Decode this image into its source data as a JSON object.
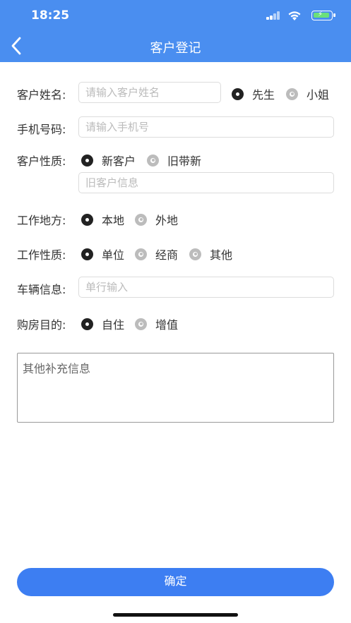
{
  "status_bar": {
    "time": "18:25"
  },
  "header": {
    "title": "客户登记"
  },
  "form": {
    "name": {
      "label": "客户姓名:",
      "placeholder": "请输入客户姓名",
      "options": [
        {
          "label": "先生",
          "selected": true
        },
        {
          "label": "小姐",
          "selected": false
        }
      ]
    },
    "phone": {
      "label": "手机号码:",
      "placeholder": "请输入手机号"
    },
    "customer_type": {
      "label": "客户性质:",
      "options": [
        {
          "label": "新客户",
          "selected": true
        },
        {
          "label": "旧带新",
          "selected": false
        }
      ],
      "old_customer_placeholder": "旧客户信息"
    },
    "work_location": {
      "label": "工作地方:",
      "options": [
        {
          "label": "本地",
          "selected": true
        },
        {
          "label": "外地",
          "selected": false
        }
      ]
    },
    "work_type": {
      "label": "工作性质:",
      "options": [
        {
          "label": "单位",
          "selected": true
        },
        {
          "label": "经商",
          "selected": false
        },
        {
          "label": "其他",
          "selected": false
        }
      ]
    },
    "vehicle": {
      "label": "车辆信息:",
      "placeholder": "单行输入"
    },
    "purchase_purpose": {
      "label": "购房目的:",
      "options": [
        {
          "label": "自住",
          "selected": true
        },
        {
          "label": "增值",
          "selected": false
        }
      ]
    },
    "extra_info": {
      "placeholder": "其他补充信息"
    }
  },
  "submit_button": {
    "label": "确定"
  },
  "colors": {
    "header": "#4a8ef0",
    "button": "#3d7ef2"
  },
  "icons": [
    "back-arrow-icon",
    "signal-icon",
    "wifi-icon",
    "battery-icon"
  ]
}
